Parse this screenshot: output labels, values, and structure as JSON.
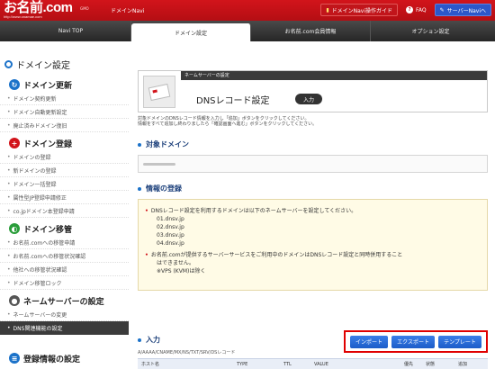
{
  "header": {
    "logo": "お名前.com",
    "logo_url": "http://www.onamae.com",
    "logo_tag": "GMO",
    "app_name": "ドメインNavi",
    "guide_label": "ドメインNavi操作ガイド",
    "faq_label": "FAQ",
    "server_navi_label": "サーバーNaviへ"
  },
  "nav": {
    "tabs": [
      {
        "label": "Navi TOP"
      },
      {
        "label": "ドメイン設定"
      },
      {
        "label": "お名前.com会員情報"
      },
      {
        "label": "オプション設定"
      }
    ]
  },
  "page_title": "ドメイン設定",
  "sidebar": {
    "sections": [
      {
        "title": "ドメイン更新",
        "items": [
          "ドメイン契約更新",
          "ドメイン自動更新設定",
          "廃止済みドメイン復旧"
        ]
      },
      {
        "title": "ドメイン登録",
        "items": [
          "ドメインの登録",
          "新ドメインの登録",
          "ドメイン一括登録",
          "属性型JP登録申請修正",
          "co.jpドメイン本登録申請"
        ]
      },
      {
        "title": "ドメイン移管",
        "items": [
          "お名前.comへの移管申請",
          "お名前.comへの移管状況確認",
          "他社への移管状況確認",
          "ドメイン移管ロック"
        ]
      },
      {
        "title": "ネームサーバーの設定",
        "items": [
          "ネームサーバーの変更",
          "DNS関連機能の設定"
        ]
      },
      {
        "title": "登録情報の設定",
        "items": []
      }
    ]
  },
  "main": {
    "banner_strip": "ネームサーバーの設定",
    "banner_title": "DNSレコード設定",
    "banner_badge": "入力",
    "desc_line1": "対象ドメインのDNSレコード情報を入力し「追加」ボタンをクリックしてください。",
    "desc_line2": "情報をすべて追加し終わりましたら「確認画面へ進む」ボタンをクリックしてください。",
    "target_domain_heading": "対象ドメイン",
    "info_heading": "情報の登録",
    "notice1": "DNSレコード設定を利用するドメインは以下のネームサーバーを設定してください。",
    "nameservers": [
      "01.dnsv.jp",
      "02.dnsv.jp",
      "03.dnsv.jp",
      "04.dnsv.jp"
    ],
    "notice2a": "お名前.comが提供するサーバーサービスをご利用中のドメインはDNSレコード設定と同時併用すること",
    "notice2b": "はできません。",
    "notice2c": "※VPS (KVM)は除く",
    "input_heading": "入力",
    "record_types": "A/AAAA/CNAME/MX/NS/TXT/SRV/DSレコード",
    "buttons": {
      "import": "インポート",
      "export": "エクスポート",
      "template": "テンプレート"
    },
    "table_headers": {
      "host": "ホスト名",
      "type": "TYPE",
      "ttl": "TTL",
      "value": "VALUE",
      "priority": "優先",
      "status": "状態",
      "add": "追加"
    }
  },
  "colors": {
    "brand_red": "#d2141b",
    "accent_blue": "#1b72c9",
    "highlight_red": "#e00000"
  }
}
